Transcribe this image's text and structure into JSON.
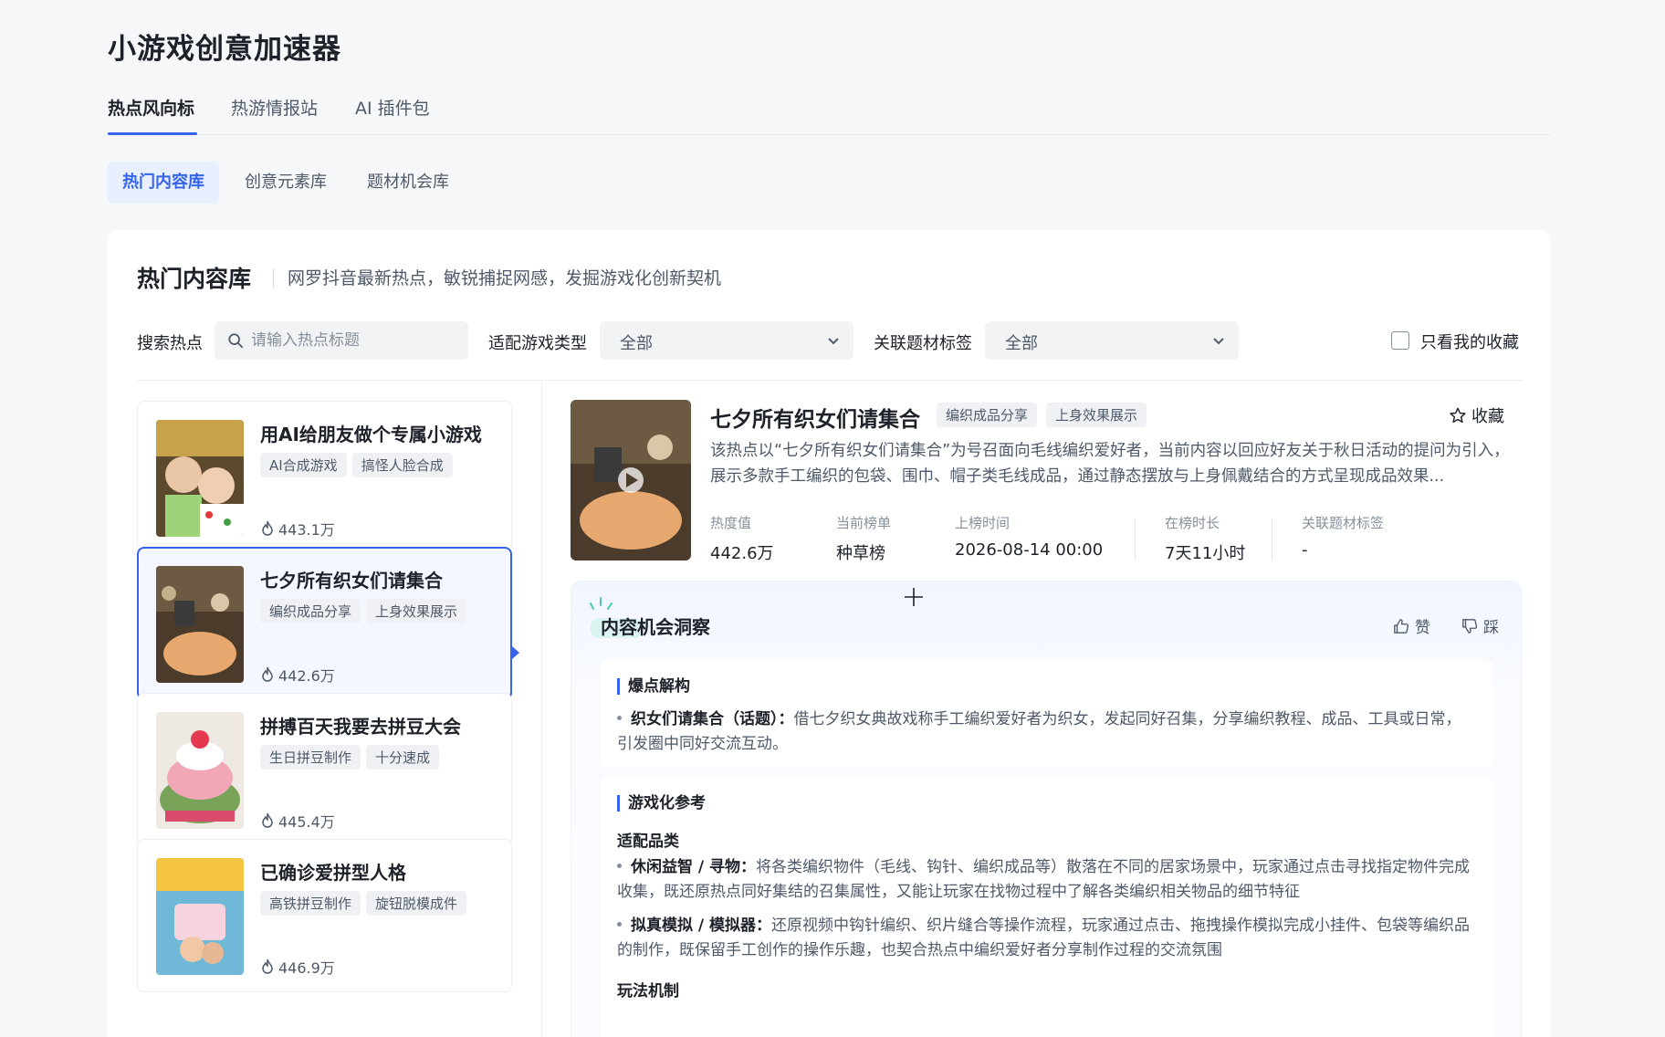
{
  "app": {
    "title": "小游戏创意加速器"
  },
  "tabs": [
    {
      "label": "热点风向标"
    },
    {
      "label": "热游情报站"
    },
    {
      "label": "AI 插件包"
    }
  ],
  "subtabs": [
    {
      "label": "热门内容库"
    },
    {
      "label": "创意元素库"
    },
    {
      "label": "题材机会库"
    }
  ],
  "panel": {
    "title": "热门内容库",
    "subtitle": "网罗抖音最新热点，敏锐捕捉网感，发掘游戏化创新契机"
  },
  "filters": {
    "search_label": "搜索热点",
    "search_placeholder": "请输入热点标题",
    "game_type_label": "适配游戏类型",
    "game_type_value": "全部",
    "tag_label": "关联题材标签",
    "tag_value": "全部",
    "favorites_label": "只看我的收藏"
  },
  "cards": [
    {
      "title": "用AI给朋友做个专属小游戏",
      "tags": [
        "AI合成游戏",
        "搞怪人脸合成"
      ],
      "heat": "443.1万"
    },
    {
      "title": "七夕所有织女们请集合",
      "tags": [
        "编织成品分享",
        "上身效果展示"
      ],
      "heat": "442.6万"
    },
    {
      "title": "拼搏百天我要去拼豆大会",
      "tags": [
        "生日拼豆制作",
        "十分速成"
      ],
      "heat": "445.4万"
    },
    {
      "title": "已确诊爱拼型人格",
      "tags": [
        "高铁拼豆制作",
        "旋钮脱模成件"
      ],
      "heat": "446.9万"
    }
  ],
  "detail": {
    "title": "七夕所有织女们请集合",
    "tags": [
      "编织成品分享",
      "上身效果展示"
    ],
    "fav_label": "收藏",
    "description": "该热点以“七夕所有织女们请集合”为号召面向毛线编织爱好者，当前内容以回应好友关于秋日活动的提问为引入，展示多款手工编织的包袋、围巾、帽子类毛线成品，通过静态摆放与上身佩戴结合的方式呈现成品效果...",
    "stats": [
      {
        "key": "热度值",
        "value": "442.6万"
      },
      {
        "key": "当前榜单",
        "value": "种草榜"
      },
      {
        "key": "上榜时间",
        "value": "2026-08-14 00:00"
      },
      {
        "key": "在榜时长",
        "value": "7天11小时"
      },
      {
        "key": "关联题材标签",
        "value": "-"
      }
    ]
  },
  "insight": {
    "title": "内容机会洞察",
    "like_label": "赞",
    "dislike_label": "踩",
    "section1": {
      "title": "爆点解构",
      "bullet_term": "织女们请集合（话题）：",
      "bullet_text": "借七夕织女典故戏称手工编织爱好者为织女，发起同好召集，分享编织教程、成品、工具或日常，引发圈中同好交流互动。"
    },
    "section2": {
      "title": "游戏化参考",
      "sub1": "适配品类",
      "bullets": [
        {
          "term": "休闲益智 / 寻物：",
          "text": "将各类编织物件（毛线、钩针、编织成品等）散落在不同的居家场景中，玩家通过点击寻找指定物件完成收集，既还原热点同好集结的召集属性，又能让玩家在找物过程中了解各类编织相关物品的细节特征"
        },
        {
          "term": "拟真模拟 / 模拟器：",
          "text": "还原视频中钩针编织、织片缝合等操作流程，玩家通过点击、拖拽操作模拟完成小挂件、包袋等编织品的制作，既保留手工创作的操作乐趣，也契合热点中编织爱好者分享制作过程的交流氛围"
        }
      ],
      "sub2": "玩法机制"
    }
  },
  "colors": {
    "accent": "#3563e9",
    "accent_bg": "#e8efff",
    "text": "#1d2129",
    "muted": "#4e5969"
  }
}
